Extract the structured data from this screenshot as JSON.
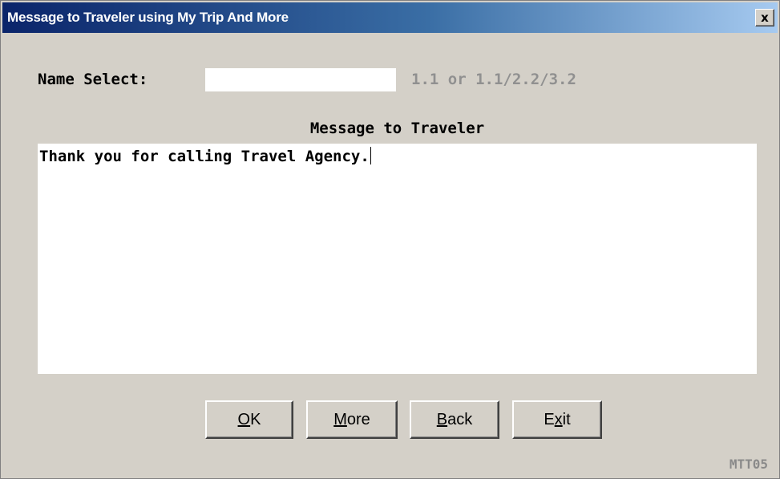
{
  "window": {
    "title": "Message to Traveler using My Trip And More",
    "close_label": "x"
  },
  "name_select": {
    "label": "Name Select:",
    "value": "",
    "hint": "1.1 or 1.1/2.2/3.2"
  },
  "message": {
    "heading": "Message to Traveler",
    "text": "Thank you for calling Travel Agency."
  },
  "buttons": {
    "ok": {
      "pre": "",
      "mnemonic": "O",
      "post": "K"
    },
    "more": {
      "pre": "",
      "mnemonic": "M",
      "post": "ore"
    },
    "back": {
      "pre": "",
      "mnemonic": "B",
      "post": "ack"
    },
    "exit": {
      "pre": "E",
      "mnemonic": "x",
      "post": "it"
    }
  },
  "footer": {
    "screen_code": "MTT05"
  }
}
